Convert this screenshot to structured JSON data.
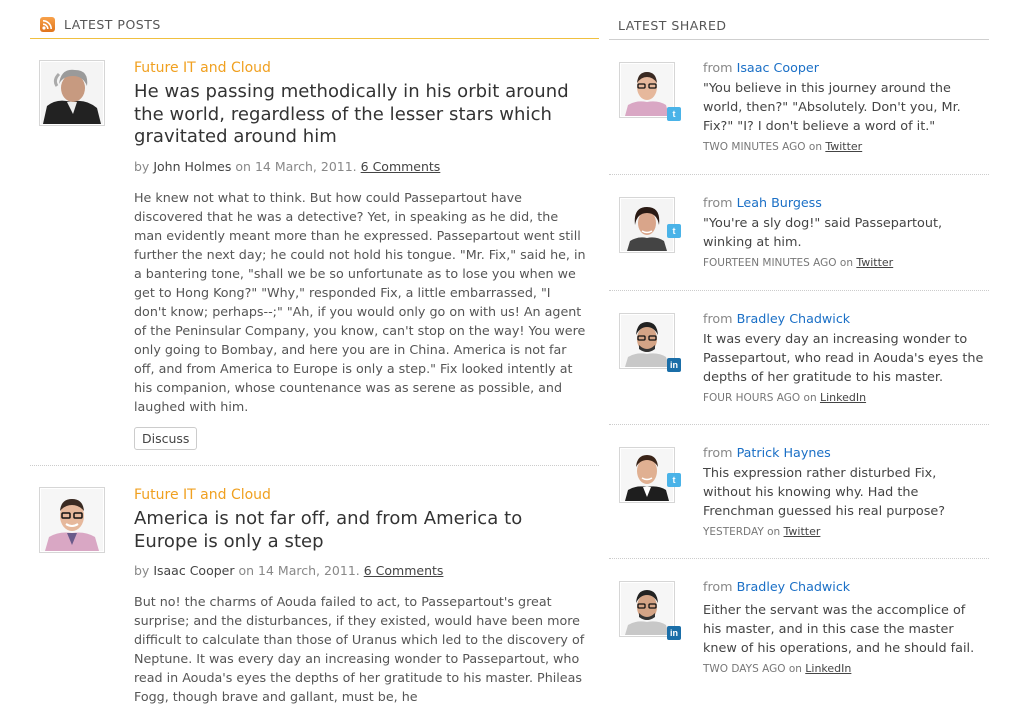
{
  "latest_posts": {
    "heading": "LATEST POSTS",
    "posts": [
      {
        "category": "Future IT and Cloud",
        "title": "He was passing methodically in his orbit around the world, regardless of the lesser stars which gravitated around him",
        "by_label": "by",
        "author": "John Holmes",
        "on_label": "on",
        "date": "14 March, 2011.",
        "comments": "6 Comments",
        "excerpt": "He knew not what to think.  But how could Passepartout have discovered that he was a detective?  Yet, in speaking as he did, the man evidently meant more than he expressed. Passepartout went still further the next day; he could not hold his tongue. \"Mr. Fix,\" said he, in a bantering tone, \"shall we be so unfortunate as to lose you when we get to Hong Kong?\" \"Why,\" responded Fix, a little embarrassed, \"I don't know; perhaps--;\" \"Ah, if you would only go on with us!  An agent of the Peninsular Company, you know, can't stop on the way!  You were only going to Bombay, and here you are in China.  America is not far off, and from America to Europe is only a step.\" Fix looked intently at his companion, whose countenance was as serene as possible, and laughed with him.",
        "discuss_label": "Discuss"
      },
      {
        "category": "Future IT and Cloud",
        "title": "America is not far off, and from America to Europe is only a step",
        "by_label": "by",
        "author": "Isaac Cooper",
        "on_label": "on",
        "date": "14 March, 2011.",
        "comments": "6 Comments",
        "excerpt": "But no! the charms of Aouda failed to act, to Passepartout's great surprise; and the disturbances, if they existed, would have been more difficult to calculate than those of Uranus which led to the discovery of Neptune. It was every day an increasing wonder to Passepartout, who read in Aouda's eyes the depths of her gratitude to his master.  Phileas Fogg, though brave and gallant, must be, he"
      }
    ]
  },
  "latest_shared": {
    "heading": "LATEST SHARED",
    "items": [
      {
        "from_label": "from",
        "name": "Isaac Cooper",
        "text": "\"You believe in this journey around the world, then?\" \"Absolutely. Don't you, Mr. Fix?\" \"I? I don't believe a word of it.\"",
        "time": "TWO MINUTES AGO",
        "on_label": "on",
        "network": "Twitter",
        "network_icon": "twitter-icon"
      },
      {
        "from_label": "from",
        "name": "Leah Burgess",
        "text": "\"You're a sly dog!\" said Passepartout, winking at him.",
        "time": "FOURTEEN MINUTES AGO",
        "on_label": "on",
        "network": "Twitter",
        "network_icon": "twitter-icon"
      },
      {
        "from_label": "from",
        "name": "Bradley Chadwick",
        "text": "It was every day an increasing wonder to Passepartout, who read in Aouda's eyes the depths of her gratitude to his master.",
        "time": "FOUR HOURS AGO",
        "on_label": "on",
        "network": "LinkedIn",
        "network_icon": "linkedin-icon"
      },
      {
        "from_label": "from",
        "name": "Patrick Haynes",
        "text": "This expression rather disturbed Fix, without his knowing why. Had the Frenchman guessed his real purpose?",
        "time": "YESTERDAY",
        "on_label": "on",
        "network": "Twitter",
        "network_icon": "twitter-icon"
      },
      {
        "from_label": "from",
        "name": "Bradley Chadwick",
        "text": "Either the servant was the accomplice of his master, and in this case the master knew of his operations, and he should fail.",
        "time": "TWO DAYS AGO",
        "on_label": "on",
        "network": "LinkedIn",
        "network_icon": "linkedin-icon"
      }
    ]
  },
  "colors": {
    "accent_orange": "#f0a020",
    "link_blue": "#1a6fc6",
    "twitter": "#4ab3e8",
    "linkedin": "#1a6ea8"
  }
}
